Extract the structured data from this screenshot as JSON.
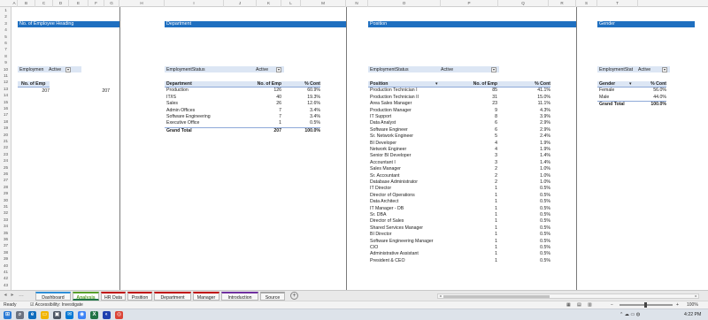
{
  "columns": [
    "A",
    "B",
    "C",
    "D",
    "E",
    "F",
    "G",
    "H",
    "I",
    "J",
    "K",
    "L",
    "M",
    "N",
    "O",
    "P",
    "Q",
    "R",
    "S",
    "T"
  ],
  "rows": [
    "1",
    "2",
    "3",
    "4",
    "5",
    "6",
    "7",
    "8",
    "9",
    "10",
    "11",
    "12",
    "13",
    "14",
    "15",
    "16",
    "17",
    "18",
    "19",
    "20",
    "21",
    "22",
    "23",
    "24",
    "25",
    "26",
    "27",
    "28",
    "29",
    "30",
    "31",
    "32",
    "33",
    "34",
    "35",
    "36",
    "37",
    "38",
    "39",
    "40",
    "41",
    "42",
    "43"
  ],
  "sections": {
    "employee": {
      "heading": "No. of Employee Heading",
      "filter_label": "Employmen",
      "filter_value": "Active",
      "table_header": "No. of Emp",
      "value": "207",
      "value2": "207"
    },
    "department": {
      "heading": "Department",
      "filter_label": "EmploymentStatus",
      "filter_value": "Active",
      "headers": [
        "Department",
        "No. of Emp",
        "% Cont"
      ],
      "rows": [
        [
          "Production",
          "126",
          "60.9%"
        ],
        [
          "IT/IS",
          "40",
          "19.3%"
        ],
        [
          "Sales",
          "26",
          "12.6%"
        ],
        [
          "Admin Offices",
          "7",
          "3.4%"
        ],
        [
          "Software Engineering",
          "7",
          "3.4%"
        ],
        [
          "Executive Office",
          "1",
          "0.5%"
        ]
      ],
      "total": [
        "Grand Total",
        "207",
        "100.0%"
      ]
    },
    "position": {
      "heading": "Position",
      "filter_label": "EmploymentStatus",
      "filter_value": "Active",
      "headers": [
        "Position",
        "No. of Emp",
        "% Cont"
      ],
      "rows": [
        [
          "Production Technician I",
          "85",
          "41.1%"
        ],
        [
          "Production Technician II",
          "31",
          "15.0%"
        ],
        [
          "Area Sales Manager",
          "23",
          "11.1%"
        ],
        [
          "Production Manager",
          "9",
          "4.3%"
        ],
        [
          "IT Support",
          "8",
          "3.9%"
        ],
        [
          "Data Analyst",
          "6",
          "2.9%"
        ],
        [
          "Software Engineer",
          "6",
          "2.9%"
        ],
        [
          "Sr. Network Engineer",
          "5",
          "2.4%"
        ],
        [
          "BI Developer",
          "4",
          "1.9%"
        ],
        [
          "Network Engineer",
          "4",
          "1.9%"
        ],
        [
          "Senior BI Developer",
          "3",
          "1.4%"
        ],
        [
          "Accountant I",
          "3",
          "1.4%"
        ],
        [
          "Sales Manager",
          "2",
          "1.0%"
        ],
        [
          "Sr. Accountant",
          "2",
          "1.0%"
        ],
        [
          "Database Administrator",
          "2",
          "1.0%"
        ],
        [
          "IT Director",
          "1",
          "0.5%"
        ],
        [
          "Director of Operations",
          "1",
          "0.5%"
        ],
        [
          "Data Architect",
          "1",
          "0.5%"
        ],
        [
          "IT Manager - DB",
          "1",
          "0.5%"
        ],
        [
          "Sr. DBA",
          "1",
          "0.5%"
        ],
        [
          "Director of Sales",
          "1",
          "0.5%"
        ],
        [
          "Shared Services Manager",
          "1",
          "0.5%"
        ],
        [
          "BI Director",
          "1",
          "0.5%"
        ],
        [
          "Software Engineering Manager",
          "1",
          "0.5%"
        ],
        [
          "CIO",
          "1",
          "0.5%"
        ],
        [
          "Administrative Assistant",
          "1",
          "0.5%"
        ],
        [
          "President & CEO",
          "1",
          "0.5%"
        ]
      ]
    },
    "gender": {
      "heading": "Gender",
      "filter_label": "EmploymentStat",
      "filter_value": "Active",
      "headers": [
        "Gender",
        "% Cont"
      ],
      "rows": [
        [
          "Female",
          "56.0%"
        ],
        [
          "Male",
          "44.0%"
        ]
      ],
      "total": [
        "Grand Total",
        "100.0%"
      ]
    }
  },
  "sheet_tabs": [
    {
      "label": "Dashboard",
      "color": "#2e8fd8"
    },
    {
      "label": "Analysis",
      "color": "#5aa02c",
      "active": true
    },
    {
      "label": "HR Data",
      "color": "#c00000"
    },
    {
      "label": "Position",
      "color": "#c00000"
    },
    {
      "label": "Department",
      "color": "#c00000"
    },
    {
      "label": "Manager",
      "color": "#c00000"
    },
    {
      "label": "Introduction",
      "color": "#7030a0"
    },
    {
      "label": "Source",
      "color": "#a6a6a6"
    }
  ],
  "statusbar": {
    "ready": "Ready",
    "accessibility": "Accessibility: Investigate",
    "zoom": "100%"
  },
  "taskbar": {
    "time": "4:22 PM"
  },
  "colors": {
    "heading_band": "#1f6fc0",
    "pivot_header": "#dce6f4",
    "active_tab": "#217346"
  }
}
